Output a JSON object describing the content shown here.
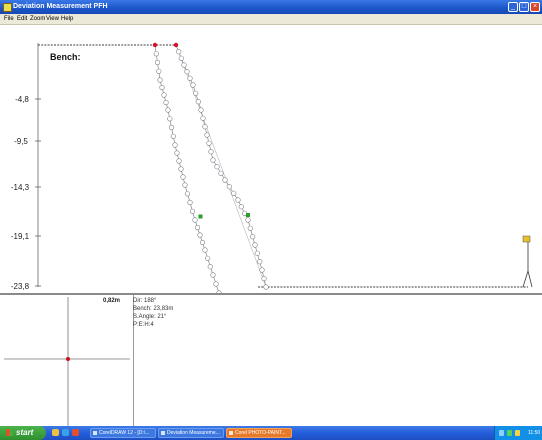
{
  "window": {
    "title": "Deviation Measurement PFH"
  },
  "menu": [
    "File",
    "Edit",
    "Zoom",
    "View",
    "Help"
  ],
  "plot": {
    "bench_label": "Bench:",
    "y_ticks": [
      "-4,8",
      "-9,5",
      "-14,3",
      "-19,1",
      "-23,8"
    ]
  },
  "info": {
    "offset": "0,82m",
    "lines": [
      "Dir: 188°",
      "Bench: 23,83m",
      "S.Angle: 21°",
      "P:E:H:4"
    ]
  },
  "taskbar": {
    "start_label": "start",
    "tasks": [
      "CorelDRAW 12 - [D:\\...",
      "Deviation Measureme...",
      "Corel PHOTO-PAINT..."
    ],
    "clock": "11:50"
  }
}
